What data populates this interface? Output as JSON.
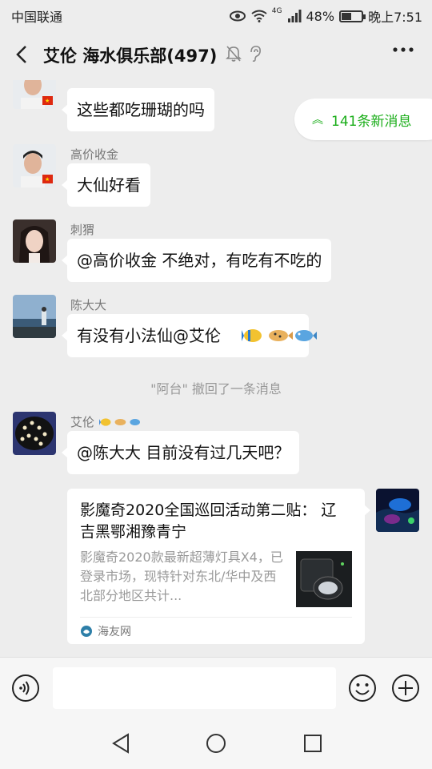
{
  "status_bar": {
    "carrier": "中国联通",
    "network": "4G",
    "battery": "48%",
    "battery_level": 0.48,
    "time": "晚上7:51"
  },
  "header": {
    "title": "艾伦 海水俱乐部(497)"
  },
  "new_messages": {
    "label": "141条新消息"
  },
  "messages": [
    {
      "sender": "高价收金",
      "text": "这些都吃珊瑚的吗"
    },
    {
      "sender": "高价收金",
      "text": "大仙好看"
    },
    {
      "sender": "刺猬",
      "text": "@高价收金  不绝对，有吃有不吃的"
    },
    {
      "sender": "陈大大",
      "text": "有没有小法仙@艾伦"
    },
    {
      "sender": "艾伦",
      "text": "@陈大大  目前没有过几天吧？"
    }
  ],
  "recall_notice": "\"阿台\" 撤回了一条消息",
  "shared_card": {
    "title": "影魔奇2020全国巡回活动第二贴： 辽吉黑鄂湘豫青宁",
    "description": "影魔奇2020款最新超薄灯具X4，已登录市场，现特针对东北/华中及西北部分地区共计...",
    "source": "海友网"
  },
  "colors": {
    "background": "#ededed",
    "accent_green": "#1aad19",
    "bubble": "#ffffff",
    "meta_text": "#999999"
  },
  "icons": {
    "back": "chevron-left-icon",
    "mute": "bell-off-icon",
    "ear": "ear-icon",
    "more": "more-dots-icon",
    "voice": "voice-icon",
    "emoji": "emoji-icon",
    "plus": "plus-icon"
  }
}
